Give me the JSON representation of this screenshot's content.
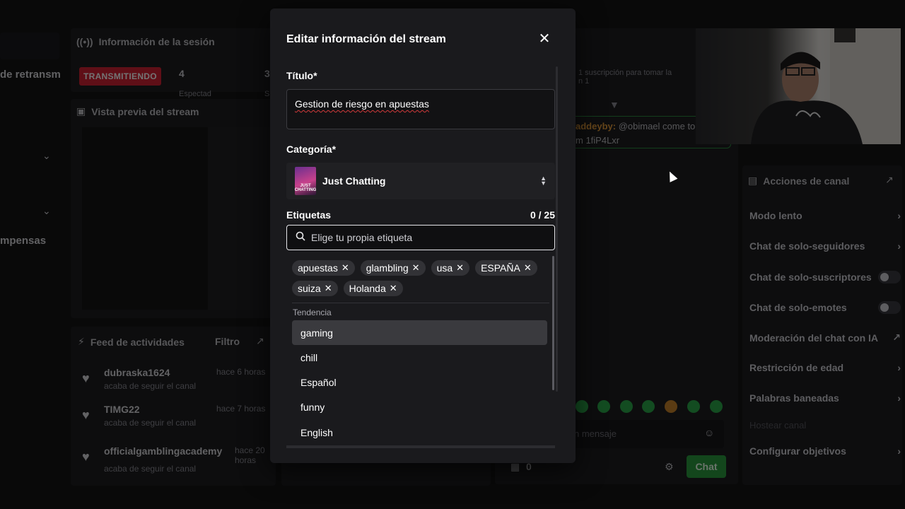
{
  "background": {
    "left_cut": {
      "retransmission": "de retransm",
      "compensas": "mpensas"
    },
    "session_panel": {
      "title": "Información de la sesión",
      "live_badge": "TRANSMITIENDO",
      "stat1": "4",
      "stat2": "3",
      "stat1_sub": "Espectad",
      "stat2_sub": "S"
    },
    "preview_panel": {
      "title": "Vista previa del stream"
    },
    "feed_panel": {
      "title": "Feed de actividades",
      "filter": "Filtro",
      "items": [
        {
          "name": "dubraska1624",
          "time": "hace 6 horas",
          "action": "acaba de seguir el canal"
        },
        {
          "name": "TIMG22",
          "time": "hace 7 horas",
          "action": "acaba de seguir el canal"
        },
        {
          "name": "officialgamblingacademy",
          "time": "hace 20 horas",
          "action": "acaba de seguir el canal"
        }
      ]
    },
    "chat": {
      "sub_notice": "1 suscripción para tomar la\nn 1",
      "user": "addeyby:",
      "message": "@obimael come to",
      "message2": "m 1fiP4Lxr",
      "input_placeholder": "n mensaje",
      "points": "0",
      "chat_button": "Chat"
    },
    "channel_actions": {
      "title": "Acciones de canal",
      "items": [
        {
          "label": "Modo lento",
          "control": "chevron"
        },
        {
          "label": "Chat de solo-seguidores",
          "control": "chevron"
        },
        {
          "label": "Chat de solo-suscriptores",
          "control": "toggle"
        },
        {
          "label": "Chat de solo-emotes",
          "control": "toggle"
        },
        {
          "label": "Moderación del chat con IA",
          "control": "external"
        },
        {
          "label": "Restricción de edad",
          "control": "chevron"
        },
        {
          "label": "Palabras baneadas",
          "control": "chevron"
        },
        {
          "label": "Hostear canal",
          "control": "none"
        },
        {
          "label": "Configurar objetivos",
          "control": "chevron"
        }
      ]
    }
  },
  "modal": {
    "title": "Editar información del stream",
    "close_icon": "close-icon",
    "title_field": {
      "label": "Título*",
      "value": "Gestion de riesgo en apuestas"
    },
    "category_field": {
      "label": "Categoría*",
      "value": "Just Chatting",
      "thumb_text": "JUST CHATTING"
    },
    "tags_field": {
      "label": "Etiquetas",
      "count": "0 / 25",
      "placeholder": "Elige tu propia etiqueta",
      "selected": [
        "apuestas",
        "glambling",
        "usa",
        "ESPAÑA",
        "suiza",
        "Holanda"
      ],
      "trending_label": "Tendencia",
      "options": [
        "gaming",
        "chill",
        "Español",
        "funny",
        "English"
      ],
      "highlighted": "gaming"
    }
  },
  "colors": {
    "live_red": "#d32233",
    "chat_green": "#2aa84a",
    "modal_bg": "#1a1a1d"
  }
}
